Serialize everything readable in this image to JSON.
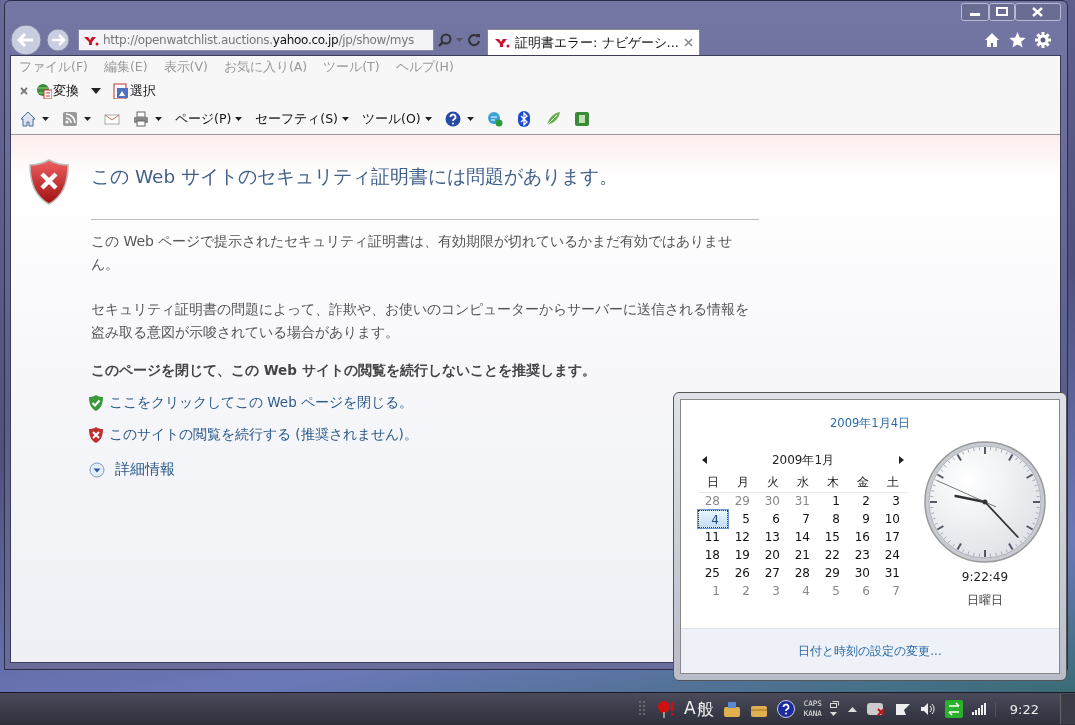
{
  "browser": {
    "address": {
      "prefix": "http://openwatchlist.auctions.",
      "domain": "yahoo.co.jp",
      "path": "/jp/show/mys"
    },
    "tabs": [
      {
        "title": "証明書エラー: ナビゲーシ...",
        "selected": true
      }
    ],
    "menu": [
      "ファイル(F)",
      "編集(E)",
      "表示(V)",
      "お気に入り(A)",
      "ツール(T)",
      "ヘルプ(H)"
    ],
    "command_bar": [
      "変換",
      "選択"
    ],
    "toolbar": [
      "ページ(P)",
      "セーフティ(S)",
      "ツール(O)"
    ]
  },
  "page": {
    "title": "この Web サイトのセキュリティ証明書には問題があります。",
    "paragraphs": [
      "この Web ページで提示されたセキュリティ証明書は、有効期限が切れているかまだ有効ではありません。",
      "セキュリティ証明書の問題によって、詐欺や、お使いのコンピューターからサーバーに送信される情報を盗み取る意図が示唆されている場合があります。"
    ],
    "recommendation": "このページを閉じて、この Web サイトの閲覧を続行しないことを推奨します。",
    "links": [
      {
        "kind": "safe",
        "text": "ここをクリックしてこの Web ページを閉じる。"
      },
      {
        "kind": "unsafe",
        "text": "このサイトの閲覧を続行する (推奨されません)。"
      }
    ],
    "more_info": "詳細情報"
  },
  "calendar": {
    "date_link": "2009年1月4日",
    "month": "2009年1月",
    "weekdays": [
      "日",
      "月",
      "火",
      "水",
      "木",
      "金",
      "土"
    ],
    "weeks": [
      [
        {
          "day": "28",
          "other_month": true,
          "selected": false
        },
        {
          "day": "29",
          "other_month": true,
          "selected": false
        },
        {
          "day": "30",
          "other_month": true,
          "selected": false
        },
        {
          "day": "31",
          "other_month": true,
          "selected": false
        },
        {
          "day": "1",
          "other_month": false,
          "selected": false
        },
        {
          "day": "2",
          "other_month": false,
          "selected": false
        },
        {
          "day": "3",
          "other_month": false,
          "selected": false
        }
      ],
      [
        {
          "day": "4",
          "other_month": false,
          "selected": true
        },
        {
          "day": "5",
          "other_month": false,
          "selected": false
        },
        {
          "day": "6",
          "other_month": false,
          "selected": false
        },
        {
          "day": "7",
          "other_month": false,
          "selected": false
        },
        {
          "day": "8",
          "other_month": false,
          "selected": false
        },
        {
          "day": "9",
          "other_month": false,
          "selected": false
        },
        {
          "day": "10",
          "other_month": false,
          "selected": false
        }
      ],
      [
        {
          "day": "11",
          "other_month": false,
          "selected": false
        },
        {
          "day": "12",
          "other_month": false,
          "selected": false
        },
        {
          "day": "13",
          "other_month": false,
          "selected": false
        },
        {
          "day": "14",
          "other_month": false,
          "selected": false
        },
        {
          "day": "15",
          "other_month": false,
          "selected": false
        },
        {
          "day": "16",
          "other_month": false,
          "selected": false
        },
        {
          "day": "17",
          "other_month": false,
          "selected": false
        }
      ],
      [
        {
          "day": "18",
          "other_month": false,
          "selected": false
        },
        {
          "day": "19",
          "other_month": false,
          "selected": false
        },
        {
          "day": "20",
          "other_month": false,
          "selected": false
        },
        {
          "day": "21",
          "other_month": false,
          "selected": false
        },
        {
          "day": "22",
          "other_month": false,
          "selected": false
        },
        {
          "day": "23",
          "other_month": false,
          "selected": false
        },
        {
          "day": "24",
          "other_month": false,
          "selected": false
        }
      ],
      [
        {
          "day": "25",
          "other_month": false,
          "selected": false
        },
        {
          "day": "26",
          "other_month": false,
          "selected": false
        },
        {
          "day": "27",
          "other_month": false,
          "selected": false
        },
        {
          "day": "28",
          "other_month": false,
          "selected": false
        },
        {
          "day": "29",
          "other_month": false,
          "selected": false
        },
        {
          "day": "30",
          "other_month": false,
          "selected": false
        },
        {
          "day": "31",
          "other_month": false,
          "selected": false
        }
      ],
      [
        {
          "day": "1",
          "other_month": true,
          "selected": false
        },
        {
          "day": "2",
          "other_month": true,
          "selected": false
        },
        {
          "day": "3",
          "other_month": true,
          "selected": false
        },
        {
          "day": "4",
          "other_month": true,
          "selected": false
        },
        {
          "day": "5",
          "other_month": true,
          "selected": false
        },
        {
          "day": "6",
          "other_month": true,
          "selected": false
        },
        {
          "day": "7",
          "other_month": true,
          "selected": false
        }
      ]
    ],
    "time": "9:22:49",
    "weekday": "日曜日",
    "settings_link": "日付と時刻の設定の変更..."
  },
  "taskbar": {
    "ime": [
      "A",
      "般"
    ],
    "caps": "CAPS",
    "kana": "KANA",
    "clock": "9:22"
  }
}
